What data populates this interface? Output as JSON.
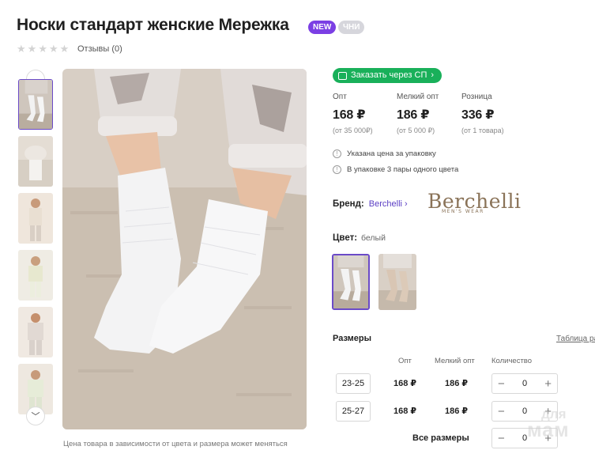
{
  "product": {
    "title": "Носки стандарт женские Мережка",
    "badges": {
      "new": "NEW",
      "chn": "ЧНИ"
    },
    "rating": {
      "stars": 5,
      "filled": 0
    },
    "reviews_label": "Отзывы (0)"
  },
  "gallery": {
    "thumb_count": 6,
    "selected_index": 0,
    "photo_note": "Цена товара в зависимости от цвета и размера может меняться"
  },
  "order": {
    "sp_button_label": "Заказать через СП",
    "prices": [
      {
        "label": "Опт",
        "value": "168 ₽",
        "note": "(от 35 000₽)"
      },
      {
        "label": "Мелкий опт",
        "value": "186 ₽",
        "note": "(от 5 000 ₽)"
      },
      {
        "label": "Розница",
        "value": "336 ₽",
        "note": "(от 1 товара)"
      }
    ],
    "info": [
      "Указана цена за упаковку",
      "В упаковке 3 пары одного цвета"
    ]
  },
  "brand": {
    "label": "Бренд:",
    "name": "Berchelli",
    "logo_text": "Berchelli",
    "logo_subtext": "MEN'S WEAR"
  },
  "color": {
    "label": "Цвет:",
    "value": "белый",
    "swatch_count": 2,
    "selected_index": 0
  },
  "sizes": {
    "title": "Размеры",
    "table_link": "Таблица ра",
    "columns": [
      "Опт",
      "Мелкий опт",
      "Количество"
    ],
    "rows": [
      {
        "size": "23-25",
        "opt": "168 ₽",
        "small_opt": "186 ₽",
        "qty": "0"
      },
      {
        "size": "25-27",
        "opt": "168 ₽",
        "small_opt": "186 ₽",
        "qty": "0"
      }
    ],
    "all_sizes_label": "Все размеры",
    "all_sizes_qty": "0"
  },
  "watermark": {
    "top": "для",
    "bottom": "мам"
  },
  "colors": {
    "accent": "#7b3fe4",
    "green": "#19b05a",
    "link": "#5b3fc4"
  }
}
